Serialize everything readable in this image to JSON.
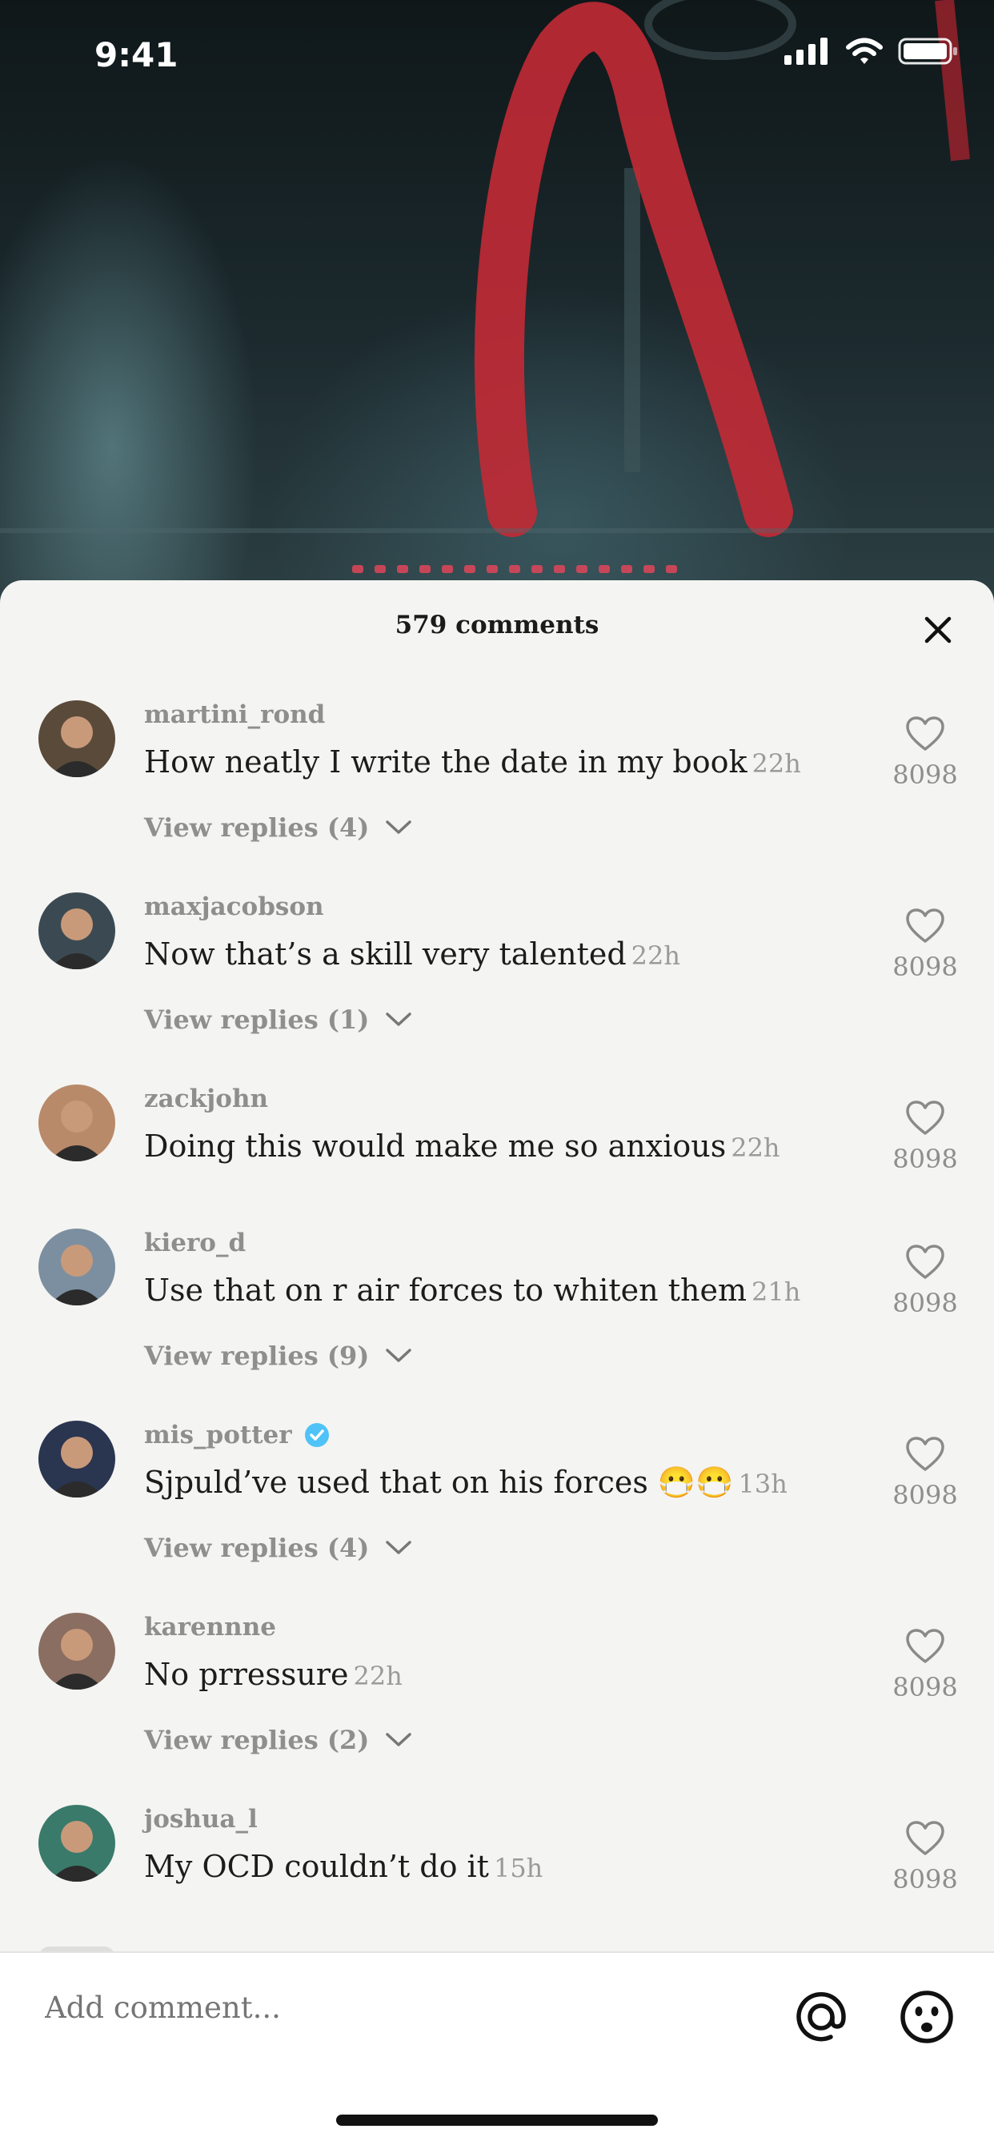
{
  "status_bar": {
    "time": "9:41"
  },
  "sheet": {
    "title": "579 comments"
  },
  "comments": [
    {
      "username": "martini_rond",
      "verified": false,
      "text": "How neatly I write the date in my book",
      "time": "22h",
      "replies_label": "View replies (4)",
      "likes": "8098",
      "avatar_color": "#5a4a3a"
    },
    {
      "username": "maxjacobson",
      "verified": false,
      "text": "Now that’s a skill very talented",
      "time": "22h",
      "replies_label": "View replies (1)",
      "likes": "8098",
      "avatar_color": "#3b4a52"
    },
    {
      "username": "zackjohn",
      "verified": false,
      "text": "Doing this would make me so anxious",
      "time": "22h",
      "replies_label": "",
      "likes": "8098",
      "avatar_color": "#b88a6a"
    },
    {
      "username": "kiero_d",
      "verified": false,
      "text": "Use that on r air forces to whiten them",
      "time": "21h",
      "replies_label": "View replies (9)",
      "likes": "8098",
      "avatar_color": "#7c8fa0"
    },
    {
      "username": "mis_potter",
      "verified": true,
      "text": "Sjpuld’ve used that on his forces 😷😷",
      "time": "13h",
      "replies_label": "View replies (4)",
      "likes": "8098",
      "avatar_color": "#2a3550"
    },
    {
      "username": "karennne",
      "verified": false,
      "text": "No prressure",
      "time": "22h",
      "replies_label": "View replies (2)",
      "likes": "8098",
      "avatar_color": "#8a6e62"
    },
    {
      "username": "joshua_l",
      "verified": false,
      "text": "My OCD couldn’t do it",
      "time": "15h",
      "replies_label": "",
      "likes": "8098",
      "avatar_color": "#3a7a6a"
    }
  ],
  "input": {
    "placeholder": "Add comment..."
  },
  "colors": {
    "sheet_bg": "#f4f4f2",
    "verified_badge": "#4fc3f7",
    "muted_text": "#8e8e8e"
  }
}
